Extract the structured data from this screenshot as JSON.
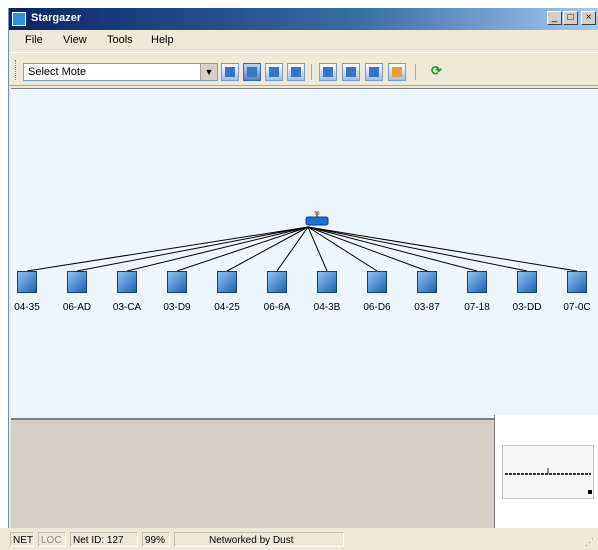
{
  "window": {
    "title": "Stargazer",
    "minimize": "_",
    "maximize": "□",
    "close": "×"
  },
  "menu": [
    "File",
    "View",
    "Tools",
    "Help"
  ],
  "toolbar": {
    "mote_select_value": "Select Mote",
    "buttons": [
      "view-mode-icon",
      "mote-view-icon",
      "path-view-icon",
      "network-view-icon",
      "zoom-in-icon",
      "zoom-out-icon",
      "zoom-fit-icon",
      "stats-icon"
    ],
    "active_button": "mote-view-icon",
    "refresh_icon": "refresh-icon"
  },
  "network": {
    "gateway_icon": "wireless-access-point-icon",
    "motes": [
      "04-35",
      "06-AD",
      "03-CA",
      "03-D9",
      "04-25",
      "06-6A",
      "04-3B",
      "06-D6",
      "03-87",
      "07-18",
      "03-DD",
      "07-0C"
    ]
  },
  "status": {
    "net": "NET",
    "loc": "LOC",
    "net_id": "Net ID: 127",
    "percent": "99%",
    "message": "Networked by Dust"
  },
  "colors": {
    "title_bar": "#0a246a",
    "canvas_bg": "#eef6fd",
    "mote": "#1e63b5",
    "link": "#000000"
  }
}
